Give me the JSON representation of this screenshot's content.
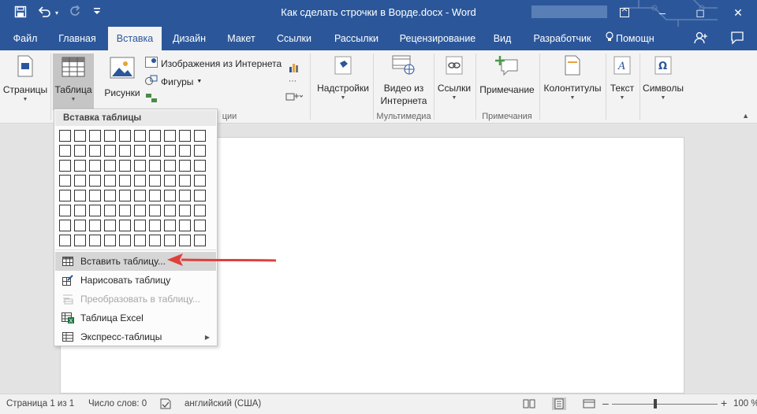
{
  "window": {
    "title": "Как сделать строчки в Ворде.docx - Word",
    "minimize_label": "–",
    "restore_label": "◻",
    "close_label": "✕",
    "ribbon_options_label": "▭"
  },
  "qat": {
    "save_icon": "save-icon",
    "undo_icon": "undo-icon",
    "redo_icon": "redo-icon",
    "customize_icon": "customize-qat-icon"
  },
  "tabs": [
    {
      "label": "Файл"
    },
    {
      "label": "Главная"
    },
    {
      "label": "Вставка"
    },
    {
      "label": "Дизайн"
    },
    {
      "label": "Макет"
    },
    {
      "label": "Ссылки"
    },
    {
      "label": "Рассылки"
    },
    {
      "label": "Рецензирование"
    },
    {
      "label": "Вид"
    },
    {
      "label": "Разработчик"
    },
    {
      "label": "Помощн"
    }
  ],
  "ribbon": {
    "pages": "Страницы",
    "table": "Таблица",
    "pictures": "Рисунки",
    "online_pictures": "Изображения из Интернета",
    "shapes": "Фигуры",
    "addins": "Надстройки",
    "online_video_1": "Видео из",
    "online_video_2": "Интернета",
    "links": "Ссылки",
    "comment": "Примечание",
    "header_footer": "Колонтитулы",
    "text": "Текст",
    "symbols": "Символы",
    "group_illustrations_tail": "ции",
    "group_multimedia": "Мультимедиа",
    "group_comments": "Примечания"
  },
  "dropdown": {
    "header": "Вставка таблицы",
    "grid_cols": 10,
    "grid_rows": 8,
    "items": [
      {
        "label": "Вставить таблицу...",
        "icon": "insert-table-icon"
      },
      {
        "label": "Нарисовать таблицу",
        "icon": "draw-table-icon"
      },
      {
        "label": "Преобразовать в таблицу...",
        "icon": "convert-to-table-icon"
      },
      {
        "label": "Таблица Excel",
        "icon": "excel-table-icon"
      },
      {
        "label": "Экспресс-таблицы",
        "icon": "quick-tables-icon"
      }
    ]
  },
  "statusbar": {
    "page": "Страница 1 из 1",
    "words": "Число слов: 0",
    "language": "английский (США)",
    "zoom_minus": "–",
    "zoom_plus": "+",
    "zoom": "100 %"
  },
  "colors": {
    "accent": "#2b579a",
    "annotation_arrow": "#e0403a"
  }
}
